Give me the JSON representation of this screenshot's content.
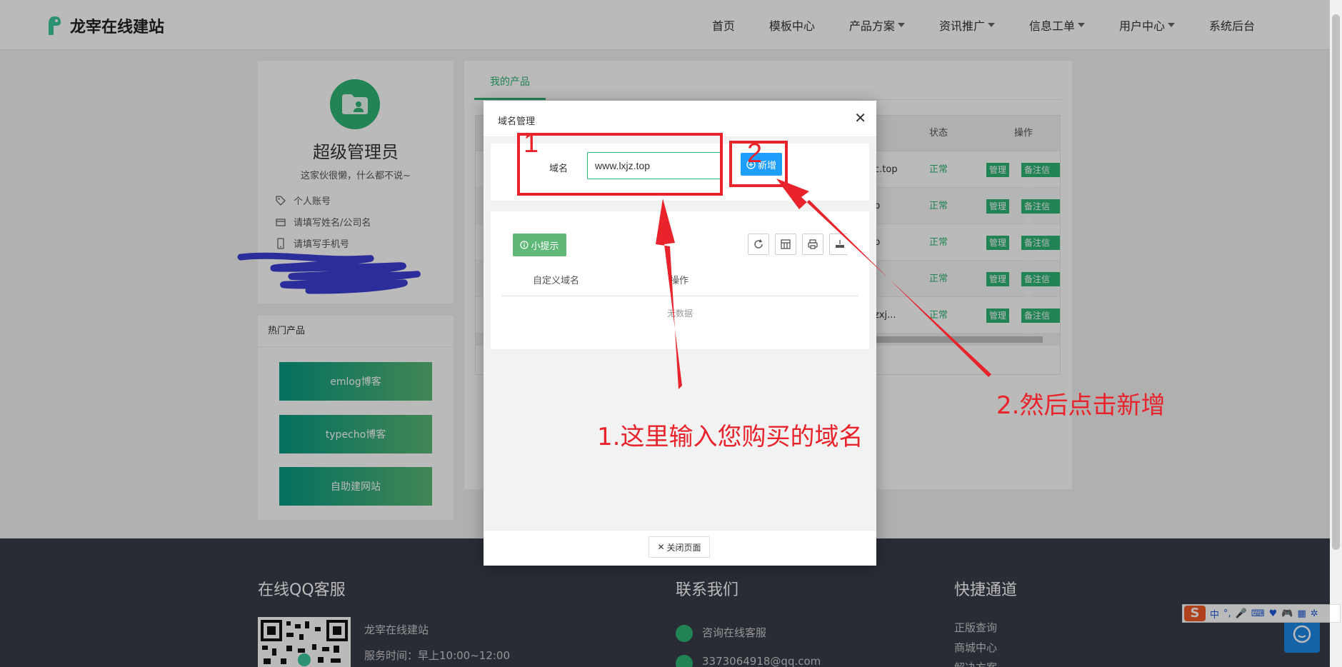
{
  "header": {
    "site_name": "龙宰在线建站",
    "nav": [
      {
        "label": "首页",
        "dropdown": false
      },
      {
        "label": "模板中心",
        "dropdown": false
      },
      {
        "label": "产品方案",
        "dropdown": true
      },
      {
        "label": "资讯推广",
        "dropdown": true
      },
      {
        "label": "信息工单",
        "dropdown": true
      },
      {
        "label": "用户中心",
        "dropdown": true
      },
      {
        "label": "系统后台",
        "dropdown": false
      }
    ]
  },
  "profile": {
    "name": "超级管理员",
    "motto": "这家伙很懒，什么都不说~",
    "rows": [
      {
        "icon": "tag-icon",
        "label": "个人账号"
      },
      {
        "icon": "card-icon",
        "label": "请填写姓名/公司名"
      },
      {
        "icon": "phone-icon",
        "label": "请填写手机号"
      }
    ]
  },
  "hot_products": {
    "title": "热门产品",
    "items": [
      "emlog博客",
      "typecho博客",
      "自助建网站"
    ]
  },
  "products": {
    "tab": "我的产品",
    "headers": {
      "status": "状态",
      "ops": "操作"
    },
    "rows": [
      {
        "domain_fragment": "c.top",
        "status": "正常",
        "manage": "管理",
        "note": "备注信息"
      },
      {
        "domain_fragment": "p",
        "status": "正常",
        "manage": "管理",
        "note": "备注信息"
      },
      {
        "domain_fragment": "p",
        "status": "正常",
        "manage": "管理",
        "note": "备注信息"
      },
      {
        "domain_fragment": "",
        "status": "正常",
        "manage": "管理",
        "note": "备注信息"
      },
      {
        "domain_fragment": "zxj...",
        "status": "正常",
        "manage": "管理",
        "note": "备注信息"
      }
    ]
  },
  "modal": {
    "title": "域名管理",
    "field_label": "域名",
    "domain_value": "www.lxjz.top",
    "add_label": "新增",
    "tip_label": "小提示",
    "col_domain": "自定义域名",
    "col_ops": "操作",
    "empty_text": "无数据",
    "close_page_label": "关闭页面"
  },
  "annotations": {
    "num1": "1",
    "num2": "2",
    "text1": "1.这里输入您购买的域名",
    "text2": "2.然后点击新增",
    "color": "#e8232b"
  },
  "footer": {
    "qq_title": "在线QQ客服",
    "contact_title": "联系我们",
    "quick_title": "快捷通道",
    "company": "龙宰在线建站",
    "hours": "服务时间：早上10:00~12:00",
    "consult": "咨询在线客服",
    "email": "3373064918@qq.com",
    "links": [
      "正版查询",
      "商城中心",
      "解决方案"
    ]
  },
  "ime": {
    "label": "中"
  },
  "colors": {
    "brand_green": "#2fb475",
    "blue": "#1e9fff",
    "footer_bg": "#393d49"
  }
}
